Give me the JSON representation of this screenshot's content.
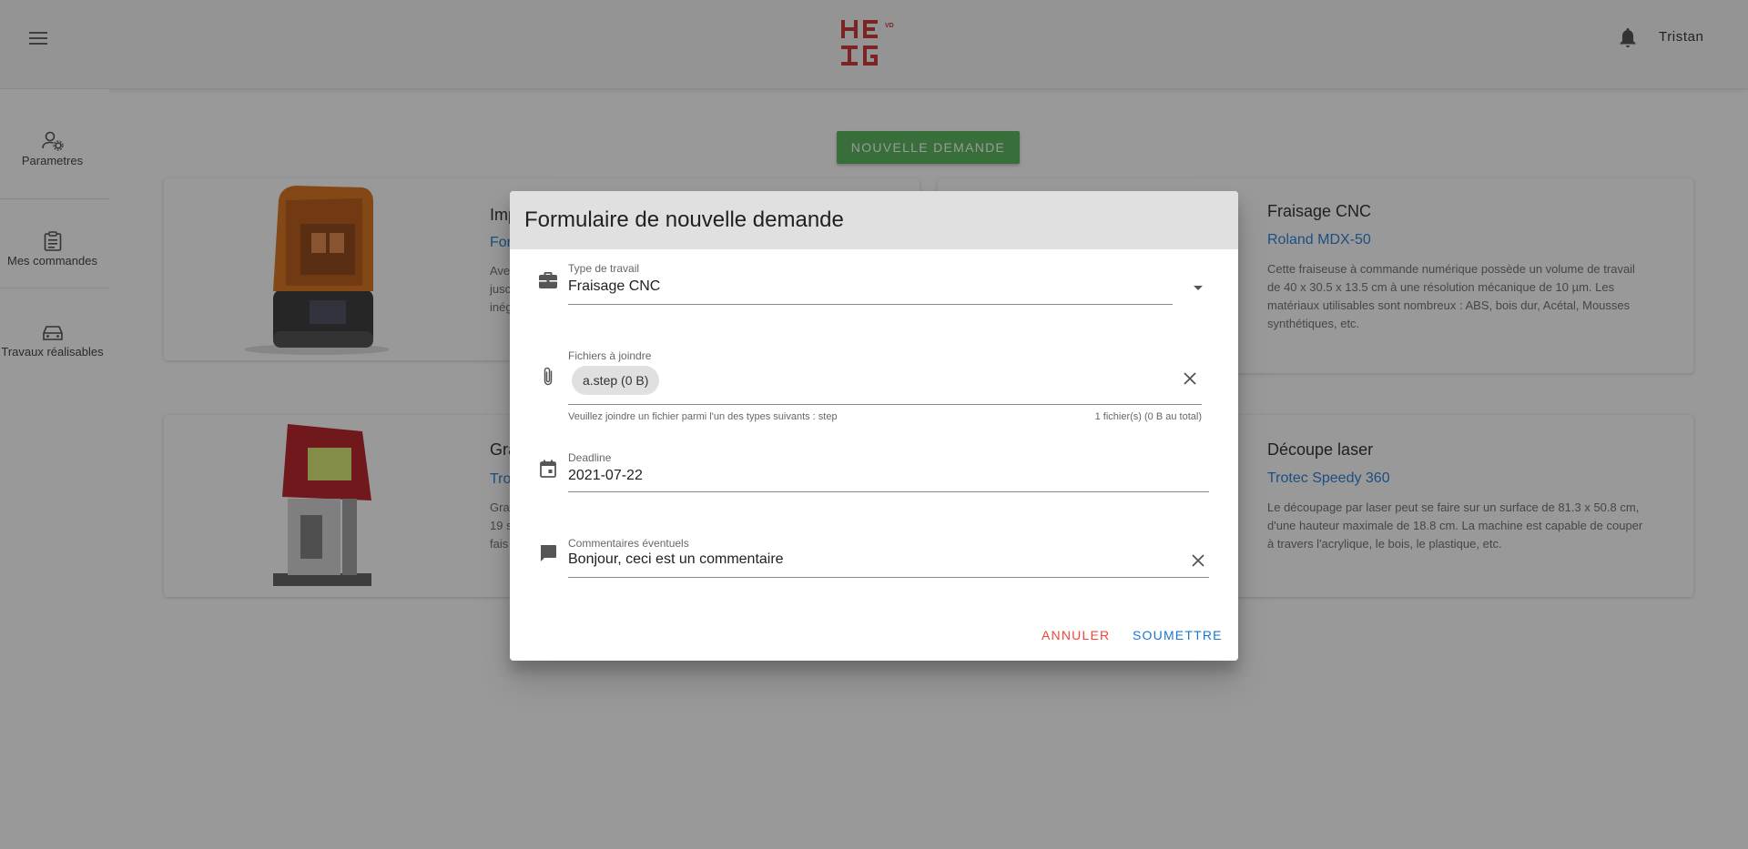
{
  "header": {
    "user_name": "Tristan",
    "logo_alt": "HEIG-VD",
    "menu_icon": "menu-icon",
    "bell_icon": "bell-icon"
  },
  "sidebar": {
    "items": [
      {
        "label": "Parametres",
        "icon": "user-settings-icon"
      },
      {
        "label": "Mes commandes",
        "icon": "clipboard-icon"
      },
      {
        "label": "Travaux réalisables",
        "icon": "car-icon"
      }
    ]
  },
  "main": {
    "new_request_label": "NOUVELLE DEMANDE",
    "cards": [
      {
        "title": "Imp",
        "subtitle": "For",
        "desc_lines": [
          "Ave",
          "jusc",
          "inég"
        ]
      },
      {
        "title": "Fraisage CNC",
        "subtitle": "Roland MDX-50",
        "desc_lines": [
          "Cette fraiseuse à commande numérique possède un volume de travail",
          "de 40 x 30.5 x 13.5 cm à une résolution mécanique de 10 µm. Les",
          "matériaux utilisables sont nombreux : ABS, bois dur, Acétal, Mousses",
          "synthétiques, etc."
        ]
      },
      {
        "title": "Gra",
        "subtitle": "Tro",
        "desc_lines": [
          "Gra",
          "19 s",
          "fais"
        ]
      },
      {
        "title": "Découpe laser",
        "subtitle": "Trotec Speedy 360",
        "desc_lines": [
          "Le découpage par laser peut se faire sur un surface de 81.3 x 50.8 cm,",
          "d'une hauteur maximale de 18.8 cm. La machine est capable de couper",
          "à travers l'acrylique, le bois, le plastique, etc."
        ]
      }
    ]
  },
  "dialog": {
    "title": "Formulaire de nouvelle demande",
    "work_type": {
      "label": "Type de travail",
      "value": "Fraisage CNC"
    },
    "files": {
      "label": "Fichiers à joindre",
      "chip": "a.step (0 B)",
      "hint": "Veuillez joindre un fichier parmi l'un des types suivants : step",
      "count": "1 fichier(s) (0 B au total)"
    },
    "deadline": {
      "label": "Deadline",
      "value": "2021-07-22"
    },
    "comments": {
      "label": "Commentaires éventuels",
      "value": "Bonjour, ceci est un commentaire"
    },
    "cancel_label": "ANNULER",
    "submit_label": "SOUMETTRE",
    "colors": {
      "cancel": "#f44336",
      "submit": "#1976d2",
      "header_bg": "#e0e0e0"
    }
  }
}
